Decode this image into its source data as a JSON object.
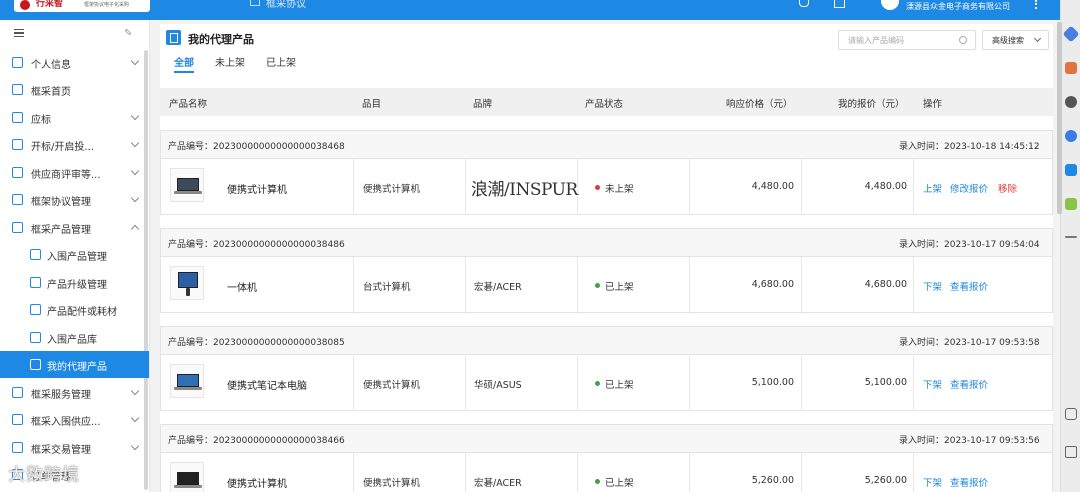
{
  "header": {
    "logo_name": "行采智",
    "logo_sub": "框架协议电子化采购",
    "nav_title": "框采协议",
    "company": "溧源县众金电子商务有限公司"
  },
  "sidebar": {
    "items": [
      {
        "label": "个人信息",
        "chevron": "down"
      },
      {
        "label": "框采首页"
      },
      {
        "label": "应标",
        "chevron": "down"
      },
      {
        "label": "开标/开启投...",
        "chevron": "down"
      },
      {
        "label": "供应商评审等...",
        "chevron": "down"
      },
      {
        "label": "框架协议管理",
        "chevron": "down"
      },
      {
        "label": "框采产品管理",
        "chevron": "up"
      },
      {
        "label": "入围产品管理",
        "sub": true
      },
      {
        "label": "产品升级管理",
        "sub": true
      },
      {
        "label": "产品配件或耗材",
        "sub": true
      },
      {
        "label": "入围产品库",
        "sub": true
      },
      {
        "label": "我的代理产品",
        "sub": true,
        "active": true
      },
      {
        "label": "框采服务管理",
        "chevron": "down"
      },
      {
        "label": "框采入围供应...",
        "chevron": "down"
      },
      {
        "label": "框采交易管理",
        "chevron": "down"
      },
      {
        "label": "订单管理"
      }
    ]
  },
  "page": {
    "title": "我的代理产品",
    "search_placeholder": "请输入产品编码",
    "advanced_search": "高级搜索",
    "tabs": [
      "全部",
      "未上架",
      "已上架"
    ],
    "active_tab": "全部"
  },
  "table": {
    "headers": [
      "产品名称",
      "品目",
      "品牌",
      "产品状态",
      "响应价格（元）",
      "我的报价（元）",
      "操作"
    ],
    "rows": [
      {
        "product_no": "产品编号：20230000000000000038468",
        "entry_time": "录入时间：2023-10-18 14:45:12",
        "name": "便携式计算机",
        "category": "便携式计算机",
        "brand": "浪潮/INSPUR",
        "status": "未上架",
        "status_color": "#e53935",
        "response_price": "4,480.00",
        "my_price": "4,480.00",
        "actions": [
          {
            "label": "上架"
          },
          {
            "label": "修改报价"
          },
          {
            "label": "移除",
            "danger": true
          }
        ],
        "icon": "laptop-icon"
      },
      {
        "product_no": "产品编号：20230000000000000038486",
        "entry_time": "录入时间：2023-10-17 09:54:04",
        "name": "一体机",
        "category": "台式计算机",
        "brand": "宏碁/ACER",
        "status": "已上架",
        "status_color": "#43a047",
        "response_price": "4,680.00",
        "my_price": "4,680.00",
        "actions": [
          {
            "label": "下架"
          },
          {
            "label": "查看报价"
          }
        ],
        "icon": "all-in-one-pc-icon"
      },
      {
        "product_no": "产品编号：20230000000000000038085",
        "entry_time": "录入时间：2023-10-17 09:53:58",
        "name": "便携式笔记本电脑",
        "category": "便携式计算机",
        "brand": "华硕/ASUS",
        "status": "已上架",
        "status_color": "#43a047",
        "response_price": "5,100.00",
        "my_price": "5,100.00",
        "actions": [
          {
            "label": "下架"
          },
          {
            "label": "查看报价"
          }
        ],
        "icon": "laptop-icon"
      },
      {
        "product_no": "产品编号：20230000000000000038466",
        "entry_time": "录入时间：2023-10-17 09:53:56",
        "name": "便携式计算机",
        "category": "便携式计算机",
        "brand": "宏碁/ACER",
        "status": "已上架",
        "status_color": "#43a047",
        "response_price": "5,260.00",
        "my_price": "5,260.00",
        "actions": [
          {
            "label": "下架"
          },
          {
            "label": "查看报价"
          }
        ],
        "icon": "laptop-icon"
      }
    ]
  },
  "watermark": "大数跨境",
  "colors": {
    "accent": "#1e88e5",
    "danger": "#e53935",
    "success": "#43a047"
  }
}
